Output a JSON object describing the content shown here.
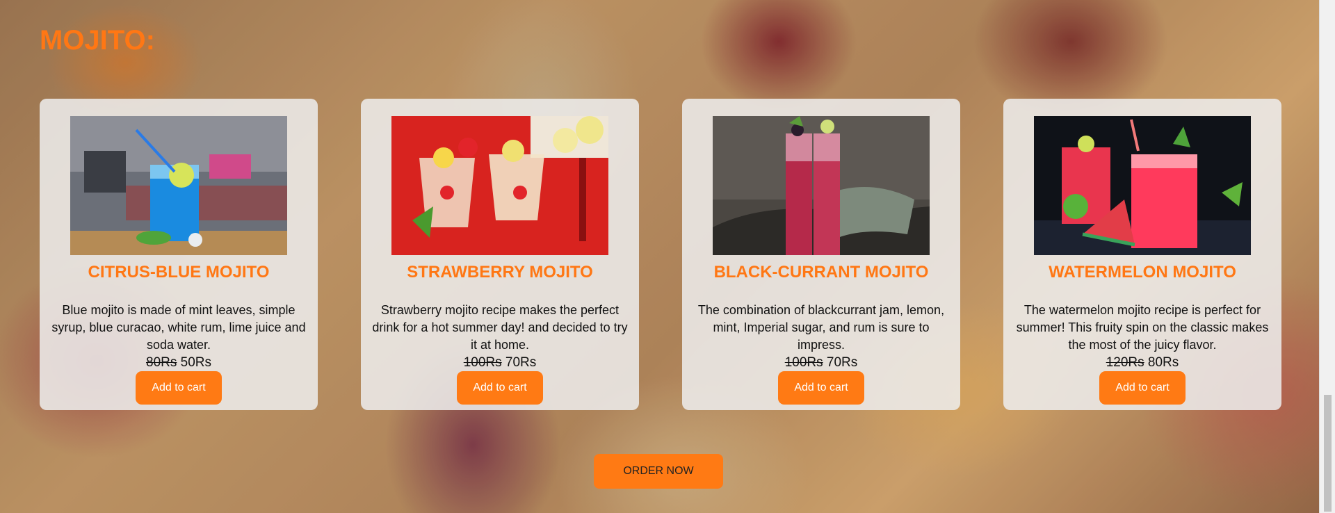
{
  "section": {
    "title": "MOJITO:"
  },
  "products": [
    {
      "name": "CITRUS-BLUE MOJITO",
      "description": "Blue mojito is made of mint leaves, simple syrup, blue curacao, white rum, lime juice and soda water.",
      "old_price": "80Rs",
      "price": "50Rs",
      "button_label": "Add to cart",
      "image_icon": "blue-mojito-photo"
    },
    {
      "name": "STRAWBERRY MOJITO",
      "description": "Strawberry mojito recipe makes the perfect drink for a hot summer day! and decided to try it at home.",
      "old_price": "100Rs",
      "price": "70Rs",
      "button_label": "Add to cart",
      "image_icon": "strawberry-mojito-photo"
    },
    {
      "name": "BLACK-CURRANT MOJITO",
      "description": "The combination of blackcurrant jam, lemon, mint, Imperial sugar, and rum is sure to impress.",
      "old_price": "100Rs",
      "price": "70Rs",
      "button_label": "Add to cart",
      "image_icon": "blackcurrant-mojito-photo"
    },
    {
      "name": "WATERMELON MOJITO",
      "description": "The watermelon mojito recipe is perfect for summer! This fruity spin on the classic makes the most of the juicy flavor.",
      "old_price": "120Rs",
      "price": "80Rs",
      "button_label": "Add to cart",
      "image_icon": "watermelon-mojito-photo"
    }
  ],
  "order": {
    "label": "ORDER NOW"
  },
  "colors": {
    "accent": "#ff7714",
    "button": "#ff7a14",
    "card_bg": "#eeeeee"
  }
}
